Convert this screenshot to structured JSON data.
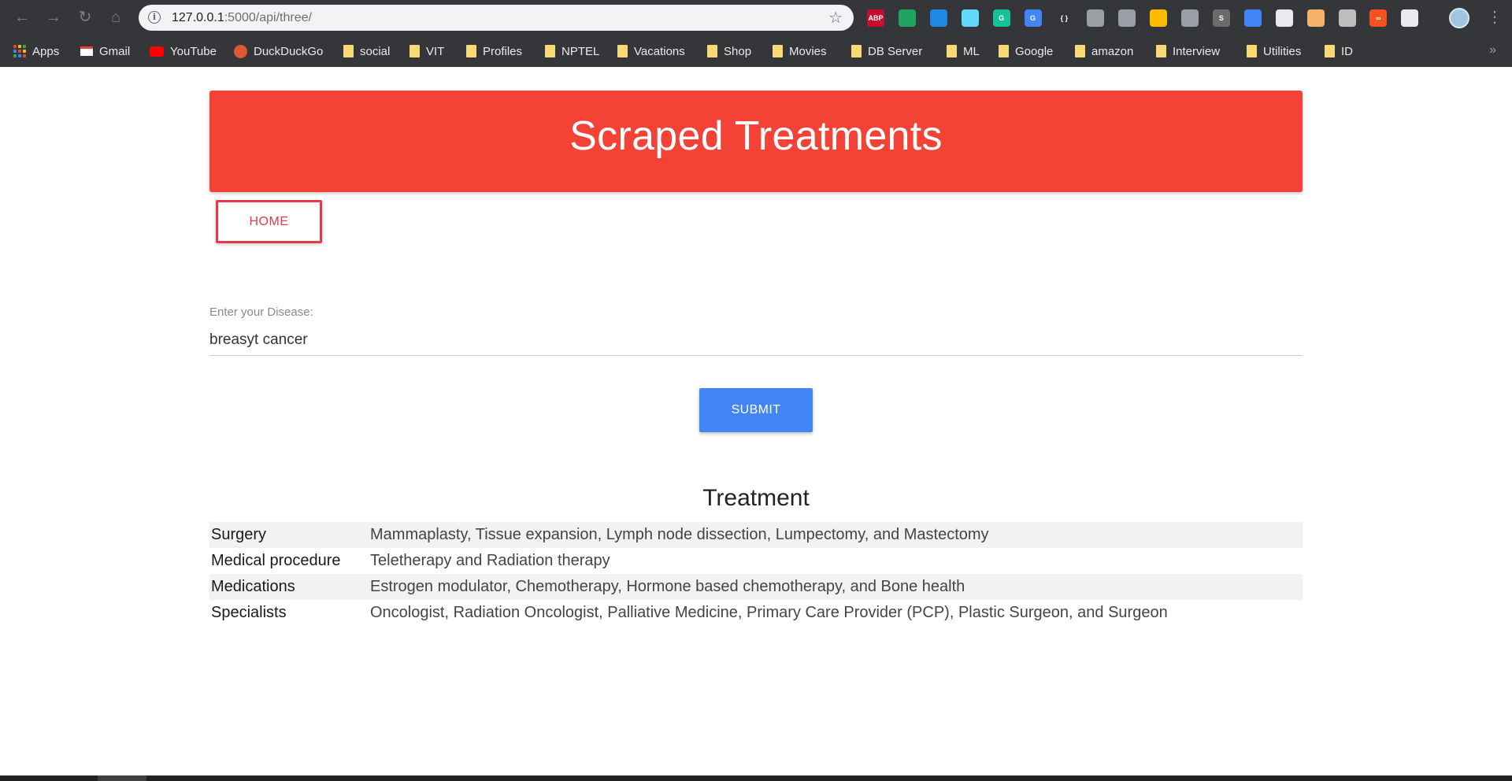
{
  "browser": {
    "url_host": "127.0.0.1",
    "url_path": ":5000/api/three/",
    "extensions": [
      {
        "name": "adblock-plus-icon",
        "label": "ABP",
        "color": "#c70d2c"
      },
      {
        "name": "green-extension-icon",
        "label": "",
        "color": "#1fa463"
      },
      {
        "name": "blue-extension-icon",
        "label": "",
        "color": "#1e88e5"
      },
      {
        "name": "react-devtools-icon",
        "label": "",
        "color": "#61dafb"
      },
      {
        "name": "grammarly-icon",
        "label": "G",
        "color": "#15c39a"
      },
      {
        "name": "google-translate-icon",
        "label": "G",
        "color": "#4285f4"
      },
      {
        "name": "json-formatter-icon",
        "label": "{ }",
        "color": "#35363a"
      },
      {
        "name": "mail-extension-icon",
        "label": "",
        "color": "#9aa0a6"
      },
      {
        "name": "settings-extension-icon",
        "label": "",
        "color": "#9aa0a6"
      },
      {
        "name": "star-extension-icon",
        "label": "",
        "color": "#fbbc04"
      },
      {
        "name": "lightbulb-extension-icon",
        "label": "",
        "color": "#9aa0a6"
      },
      {
        "name": "s-extension-icon",
        "label": "S",
        "color": "#6b6b6b"
      },
      {
        "name": "sync-extension-icon",
        "label": "",
        "color": "#4285f4"
      },
      {
        "name": "pen-extension-icon",
        "label": "",
        "color": "#e8eaed"
      },
      {
        "name": "chart-extension-icon",
        "label": "",
        "color": "#f6b26b"
      },
      {
        "name": "note-extension-icon",
        "label": "",
        "color": "#bdbdbd"
      },
      {
        "name": "infinity-extension-icon",
        "label": "∞",
        "color": "#f4511e"
      },
      {
        "name": "github-extension-icon",
        "label": "",
        "color": "#e8eaed"
      }
    ]
  },
  "bookmarks": [
    {
      "label": "Apps",
      "type": "apps"
    },
    {
      "label": "Gmail",
      "type": "gmail"
    },
    {
      "label": "YouTube",
      "type": "youtube"
    },
    {
      "label": "DuckDuckGo",
      "type": "duckduckgo"
    },
    {
      "label": "social",
      "type": "folder"
    },
    {
      "label": "VIT",
      "type": "folder"
    },
    {
      "label": "Profiles",
      "type": "folder"
    },
    {
      "label": "NPTEL",
      "type": "folder"
    },
    {
      "label": "Vacations",
      "type": "folder"
    },
    {
      "label": "Shop",
      "type": "folder"
    },
    {
      "label": "Movies",
      "type": "folder"
    },
    {
      "label": "DB Server",
      "type": "folder"
    },
    {
      "label": "ML",
      "type": "folder"
    },
    {
      "label": "Google",
      "type": "folder"
    },
    {
      "label": "amazon",
      "type": "folder"
    },
    {
      "label": "Interview",
      "type": "folder"
    },
    {
      "label": "Utilities",
      "type": "folder"
    },
    {
      "label": "ID",
      "type": "folder"
    }
  ],
  "page": {
    "title": "Scraped Treatments",
    "home_label": "HOME",
    "field_label": "Enter your Disease:",
    "field_value": "breasyt cancer",
    "submit_label": "SUBMIT",
    "treatment_heading": "Treatment",
    "treatments": [
      {
        "category": "Surgery",
        "items": "Mammaplasty, Tissue expansion, Lymph node dissection, Lumpectomy, and Mastectomy"
      },
      {
        "category": "Medical procedure",
        "items": "Teletherapy and Radiation therapy"
      },
      {
        "category": "Medications",
        "items": "Estrogen modulator, Chemotherapy, Hormone based chemotherapy, and Bone health"
      },
      {
        "category": "Specialists",
        "items": "Oncologist, Radiation Oncologist, Palliative Medicine, Primary Care Provider (PCP), Plastic Surgeon, and Surgeon"
      }
    ]
  },
  "colors": {
    "header_red": "#f44336",
    "home_red": "#e53946",
    "submit_blue": "#4285f4"
  }
}
